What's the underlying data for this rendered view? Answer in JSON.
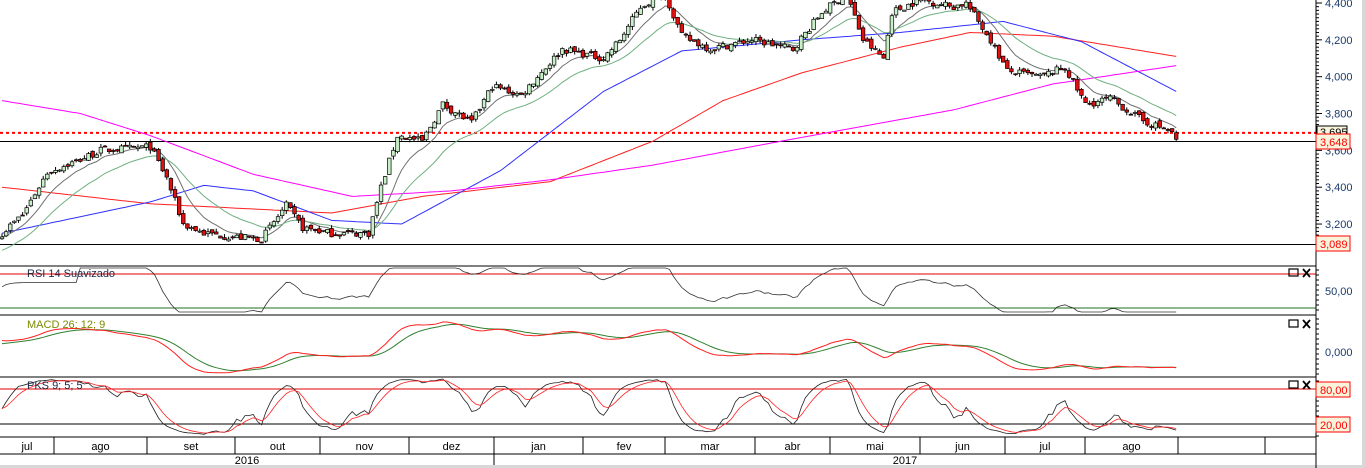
{
  "chart_data": {
    "type": "candlestick",
    "x_unit": "trading day index",
    "xlim": [
      0,
      319
    ],
    "ylim": [
      3030,
      4420
    ],
    "price_ticks": [
      "4,400",
      "4,200",
      "4,000",
      "3,800",
      "3,600",
      "3,400",
      "3,200"
    ],
    "price_tick_values": [
      4400,
      4200,
      4000,
      3800,
      3600,
      3400,
      3200
    ],
    "markers": [
      {
        "label": "3,695",
        "value": 3695,
        "style": "dotted",
        "color": "#ff0000"
      },
      {
        "label": "3,648",
        "value": 3648,
        "style": "solid",
        "color": "#000000"
      },
      {
        "label": "3,089",
        "value": 3089,
        "style": "solid",
        "color": "#000000"
      }
    ],
    "price_path": [
      [
        0,
        3150
      ],
      [
        5,
        3250
      ],
      [
        11,
        3480
      ],
      [
        19,
        3550
      ],
      [
        24,
        3600
      ],
      [
        36,
        3620
      ],
      [
        40,
        3450
      ],
      [
        44,
        3200
      ],
      [
        49,
        3150
      ],
      [
        56,
        3130
      ],
      [
        63,
        3120
      ],
      [
        69,
        3300
      ],
      [
        73,
        3180
      ],
      [
        80,
        3150
      ],
      [
        89,
        3150
      ],
      [
        92,
        3400
      ],
      [
        96,
        3680
      ],
      [
        102,
        3650
      ],
      [
        107,
        3850
      ],
      [
        114,
        3750
      ],
      [
        119,
        3950
      ],
      [
        126,
        3900
      ],
      [
        136,
        4150
      ],
      [
        146,
        4100
      ],
      [
        150,
        4200
      ],
      [
        155,
        4380
      ],
      [
        161,
        4450
      ],
      [
        165,
        4220
      ],
      [
        172,
        4150
      ],
      [
        182,
        4200
      ],
      [
        192,
        4150
      ],
      [
        199,
        4350
      ],
      [
        205,
        4450
      ],
      [
        209,
        4200
      ],
      [
        214,
        4100
      ],
      [
        216,
        4350
      ],
      [
        223,
        4420
      ],
      [
        231,
        4380
      ],
      [
        234,
        4400
      ],
      [
        240,
        4200
      ],
      [
        244,
        4030
      ],
      [
        252,
        4000
      ],
      [
        258,
        4050
      ],
      [
        263,
        3850
      ],
      [
        269,
        3880
      ],
      [
        277,
        3760
      ],
      [
        284,
        3700
      ],
      [
        285,
        3648
      ]
    ],
    "moving_averages": [
      {
        "name": "red",
        "color": "#ff2020",
        "points": [
          [
            0,
            3400
          ],
          [
            36,
            3310
          ],
          [
            80,
            3260
          ],
          [
            102,
            3350
          ],
          [
            133,
            3430
          ],
          [
            158,
            3650
          ],
          [
            175,
            3870
          ],
          [
            194,
            4020
          ],
          [
            218,
            4160
          ],
          [
            235,
            4240
          ],
          [
            255,
            4220
          ],
          [
            285,
            4110
          ]
        ]
      },
      {
        "name": "blue",
        "color": "#3030ff",
        "points": [
          [
            0,
            3150
          ],
          [
            36,
            3320
          ],
          [
            49,
            3410
          ],
          [
            61,
            3380
          ],
          [
            80,
            3220
          ],
          [
            97,
            3200
          ],
          [
            121,
            3490
          ],
          [
            146,
            3920
          ],
          [
            165,
            4140
          ],
          [
            194,
            4200
          ],
          [
            218,
            4240
          ],
          [
            243,
            4300
          ],
          [
            262,
            4190
          ],
          [
            285,
            3920
          ]
        ]
      },
      {
        "name": "magenta",
        "color": "#ff00ff",
        "points": [
          [
            0,
            3870
          ],
          [
            19,
            3800
          ],
          [
            36,
            3680
          ],
          [
            61,
            3470
          ],
          [
            85,
            3350
          ],
          [
            109,
            3380
          ],
          [
            133,
            3440
          ],
          [
            158,
            3520
          ],
          [
            194,
            3670
          ],
          [
            231,
            3820
          ],
          [
            255,
            3960
          ],
          [
            285,
            4060
          ]
        ]
      }
    ],
    "indicators": [
      {
        "name": "rsi",
        "label": "RSI 14 Suavizado",
        "tick": "50,00",
        "levels": [
          70,
          30
        ]
      },
      {
        "name": "macd",
        "label": "MACD 26; 12; 9",
        "tick": "0,000"
      },
      {
        "name": "pks",
        "label": "PKS 9; 5; 5",
        "levels_labels": [
          "80,00",
          "20,00"
        ],
        "levels": [
          80,
          20
        ]
      }
    ],
    "months": [
      "jul",
      "ago",
      "set",
      "out",
      "nov",
      "dez",
      "jan",
      "fev",
      "mar",
      "abr",
      "mai",
      "jun",
      "jul",
      "ago",
      "",
      ""
    ],
    "years": [
      "2016",
      "2017"
    ],
    "colors": {
      "up": "#c8f0c8",
      "down": "#e01010",
      "ema_fast": "#707070",
      "ema_slow": "#70b080"
    }
  }
}
